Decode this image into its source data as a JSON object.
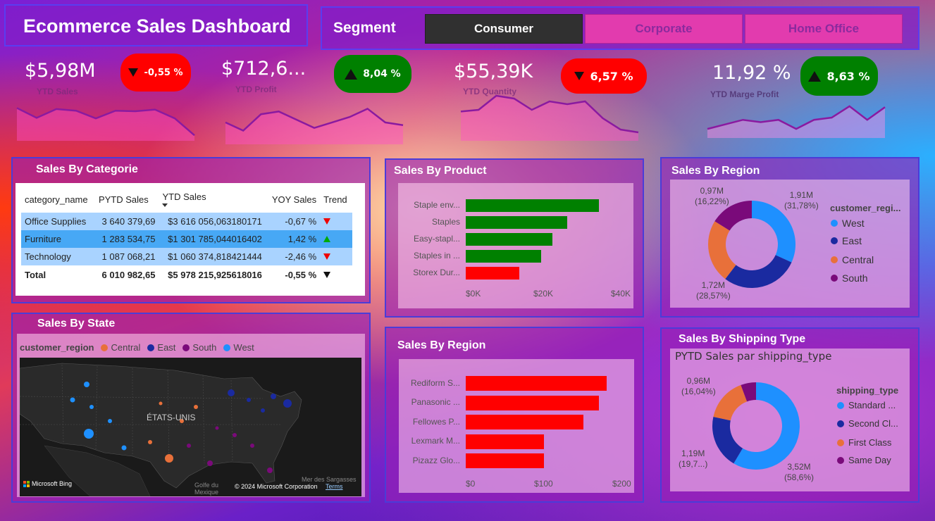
{
  "header": {
    "title": "Ecommerce Sales Dashboard"
  },
  "segment": {
    "label": "Segment",
    "options": [
      "Consumer",
      "Corporate",
      "Home Office"
    ],
    "selected": "Consumer"
  },
  "kpis": [
    {
      "value": "$5,98M",
      "label": "YTD Sales",
      "change": "-0,55 %",
      "direction": "down",
      "color": "#ff0000"
    },
    {
      "value": "$712,6...",
      "label": "YTD Profit",
      "change": "8,04 %",
      "direction": "up",
      "color": "#008000"
    },
    {
      "value": "$55,39K",
      "label": "YTD Quantity",
      "change": "6,57 %",
      "direction": "down",
      "color": "#ff0000"
    },
    {
      "value": "11,92 %",
      "label": "YTD Marge Profit",
      "change": "8,63 %",
      "direction": "up",
      "color": "#008000"
    }
  ],
  "category_table": {
    "title": "Sales By Categorie",
    "columns": [
      "category_name",
      "PYTD Sales",
      "YTD Sales",
      "YOY Sales",
      "Trend"
    ],
    "rows": [
      {
        "category": "Office Supplies",
        "pytd": "3 640 379,69",
        "ytd": "$3 616 056,063180171",
        "yoy": "-0,67 %",
        "trend": "down"
      },
      {
        "category": "Furniture",
        "pytd": "1 283 534,75",
        "ytd": "$1 301 785,044016402",
        "yoy": "1,42 %",
        "trend": "up"
      },
      {
        "category": "Technology",
        "pytd": "1 087 068,21",
        "ytd": "$1 060 374,818421444",
        "yoy": "-2,46 %",
        "trend": "down"
      }
    ],
    "total": {
      "label": "Total",
      "pytd": "6 010 982,65",
      "ytd": "$5 978 215,925618016",
      "yoy": "-0,55 %",
      "trend": "down"
    }
  },
  "product_chart": {
    "title": "Sales By Product",
    "colors": {
      "positive": "#008000",
      "negative": "#ff0000"
    }
  },
  "region_donut": {
    "title": "Sales By Region",
    "legend_title": "customer_regi...",
    "labels": [
      {
        "value": "1,91M",
        "pct": "(31,78%)"
      },
      {
        "value": "1,72M",
        "pct": "(28,57%)"
      },
      {
        "value": "0,97M",
        "pct": "(16,22%)"
      }
    ]
  },
  "state_map": {
    "title": "Sales By State",
    "legend_title": "customer_region",
    "legend": [
      {
        "name": "Central",
        "color": "#e8703a"
      },
      {
        "name": "East",
        "color": "#1a2aa0"
      },
      {
        "name": "South",
        "color": "#7a0a7a"
      },
      {
        "name": "West",
        "color": "#1e90ff"
      }
    ],
    "country_label": "ÉTATS-UNIS",
    "sea_label": "Mer des Sargasses",
    "gulf_label": "Golfe du\nMexique",
    "bing_label": "Microsoft Bing",
    "copyright": "© 2024 Microsoft Corporation",
    "terms": "Terms"
  },
  "region_bars": {
    "title": "Sales By Region",
    "color": "#ff0000"
  },
  "shipping_donut": {
    "title": "Sales By Shipping Type",
    "subtitle": "PYTD Sales par shipping_type",
    "legend_title": "shipping_type",
    "labels": [
      {
        "value": "0,96M",
        "pct": "(16,04%)"
      },
      {
        "value": "1,19M",
        "pct": "(19,7...)"
      },
      {
        "value": "3,52M",
        "pct": "(58,6%)"
      }
    ]
  },
  "chart_data": [
    {
      "type": "bar",
      "title": "Sales By Product",
      "categories": [
        "Staple env...",
        "Staples",
        "Easy-stapl...",
        "Staples in ...",
        "Storex Dur..."
      ],
      "values": [
        36000,
        27500,
        23500,
        20500,
        14500
      ],
      "colors": [
        "#008000",
        "#008000",
        "#008000",
        "#008000",
        "#ff0000"
      ],
      "xlim": [
        0,
        42000
      ],
      "xticks": [
        "$0K",
        "$20K",
        "$40K"
      ]
    },
    {
      "type": "bar",
      "title": "Sales By Region",
      "categories": [
        "Rediform S...",
        "Panasonic ...",
        "Fellowes P...",
        "Lexmark M...",
        "Pizazz Glo..."
      ],
      "values": [
        180,
        170,
        150,
        100,
        100
      ],
      "xlim": [
        0,
        200
      ],
      "xticks": [
        "$0",
        "$100",
        "$200"
      ]
    },
    {
      "type": "pie",
      "title": "Sales By Region",
      "series": [
        {
          "name": "West",
          "value": 1.91,
          "pct": 31.78,
          "color": "#1e90ff"
        },
        {
          "name": "East",
          "value": 1.72,
          "pct": 28.57,
          "color": "#1a2aa0"
        },
        {
          "name": "Central",
          "value": 1.41,
          "pct": 23.43,
          "color": "#e8703a"
        },
        {
          "name": "South",
          "value": 0.97,
          "pct": 16.22,
          "color": "#7a0a7a"
        }
      ]
    },
    {
      "type": "pie",
      "title": "Sales By Shipping Type",
      "series": [
        {
          "name": "Standard ...",
          "value": 3.52,
          "pct": 58.6,
          "color": "#1e90ff"
        },
        {
          "name": "Second Cl...",
          "value": 1.19,
          "pct": 19.7,
          "color": "#1a2aa0"
        },
        {
          "name": "First Class",
          "value": 0.96,
          "pct": 16.04,
          "color": "#e8703a"
        },
        {
          "name": "Same Day",
          "value": 0.34,
          "pct": 5.66,
          "color": "#7a0a7a"
        }
      ]
    },
    {
      "type": "area",
      "title": "YTD Sales",
      "values": [
        60,
        42,
        58,
        55,
        41,
        55,
        54,
        57,
        41,
        10
      ]
    },
    {
      "type": "area",
      "title": "YTD Profit",
      "values": [
        40,
        25,
        55,
        60,
        45,
        30,
        40,
        50,
        65,
        40,
        35
      ]
    },
    {
      "type": "area",
      "title": "YTD Quantity",
      "values": [
        52,
        55,
        80,
        75,
        55,
        70,
        65,
        70,
        40,
        20,
        15
      ]
    },
    {
      "type": "area",
      "title": "YTD Marge Profit",
      "values": [
        20,
        30,
        40,
        35,
        40,
        20,
        40,
        45,
        70,
        40,
        68
      ]
    }
  ]
}
